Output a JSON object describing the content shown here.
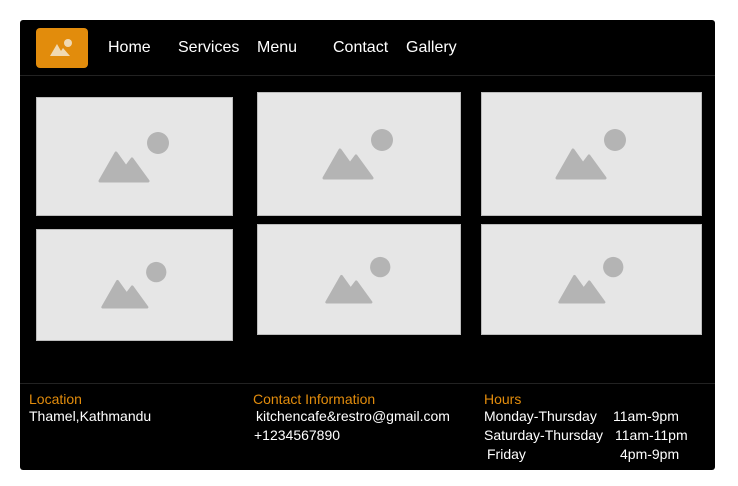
{
  "nav": {
    "logo_icon": "image-placeholder-icon",
    "links": [
      "Home",
      "Services",
      "Menu",
      "Contact",
      "Gallery"
    ]
  },
  "gallery": {
    "image_icon": "image-placeholder-icon",
    "count": 6
  },
  "footer": {
    "location": {
      "title": "Location",
      "text": "Thamel,Kathmandu"
    },
    "contact": {
      "title": "Contact Information",
      "email": "kitchencafe&restro@gmail.com",
      "phone": "+1234567890"
    },
    "hours": {
      "title": "Hours",
      "rows": [
        {
          "days": "Monday-Thursday",
          "time": "11am-9pm"
        },
        {
          "days": "Saturday-Thursday",
          "time": "11am-11pm"
        },
        {
          "days": "Friday",
          "time": "4pm-9pm"
        }
      ]
    }
  },
  "colors": {
    "accent": "#e28c0c",
    "background": "#000000",
    "placeholder": "#e6e6e6"
  }
}
